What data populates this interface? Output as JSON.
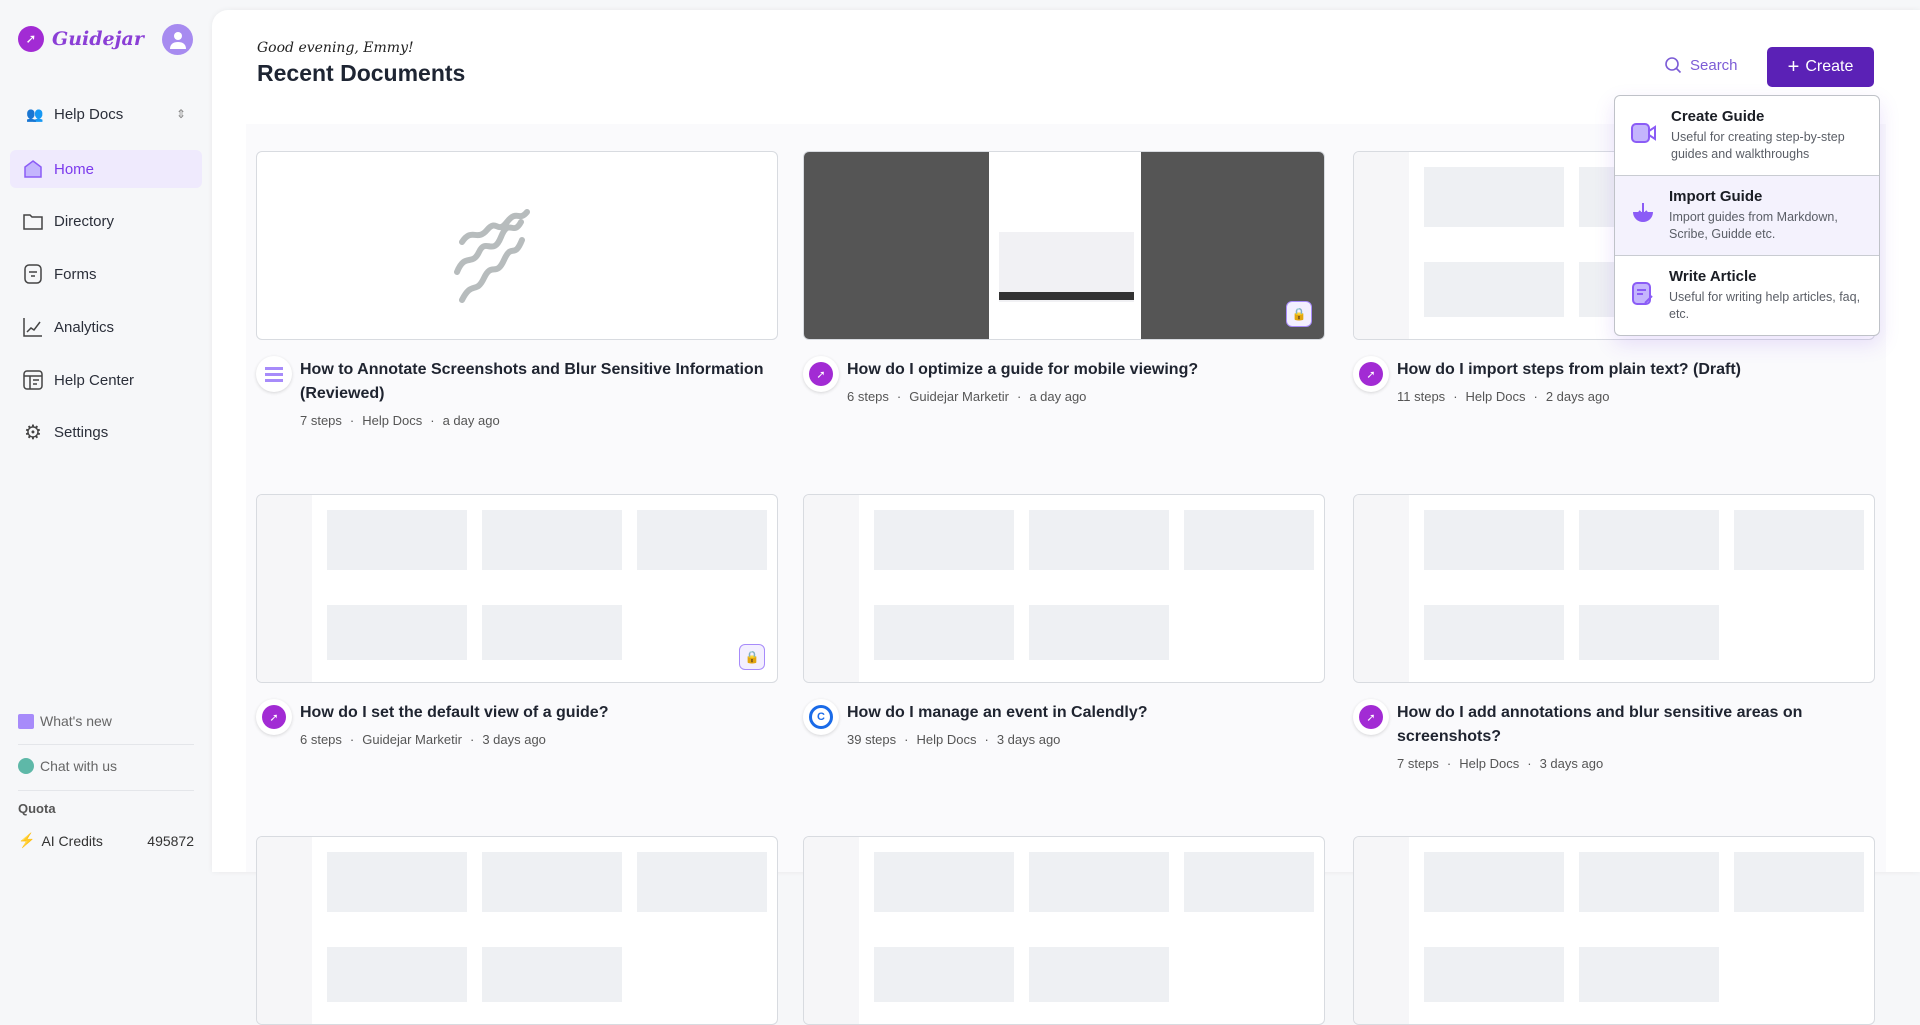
{
  "app": {
    "name": "Guidejar"
  },
  "sidebar": {
    "workspace": "Help Docs",
    "items": [
      {
        "label": "Home",
        "icon": "home-icon"
      },
      {
        "label": "Directory",
        "icon": "folder-icon"
      },
      {
        "label": "Forms",
        "icon": "form-icon"
      },
      {
        "label": "Analytics",
        "icon": "chart-icon"
      },
      {
        "label": "Help Center",
        "icon": "help-center-icon"
      },
      {
        "label": "Settings",
        "icon": "gear-icon"
      }
    ],
    "whats_new": "What's new",
    "chat": "Chat with us",
    "quota_label": "Quota",
    "credits_label": "AI Credits",
    "credits_value": "495872"
  },
  "header": {
    "greeting": "Good evening, Emmy!",
    "title": "Recent Documents",
    "search": "Search",
    "create": "Create"
  },
  "create_menu": [
    {
      "title": "Create Guide",
      "desc": "Useful for creating step-by-step guides and walkthroughs"
    },
    {
      "title": "Import Guide",
      "desc": "Import guides from Markdown, Scribe, Guidde etc."
    },
    {
      "title": "Write Article",
      "desc": "Useful for writing help articles, faq, etc."
    }
  ],
  "documents": [
    {
      "title": "How to Annotate Screenshots and Blur Sensitive Information (Reviewed)",
      "steps": "7 steps",
      "folder": "Help Docs",
      "time": "a day ago"
    },
    {
      "title": "How do I optimize a guide for mobile viewing?",
      "steps": "6 steps",
      "folder": "Guidejar Marketir",
      "time": "a day ago"
    },
    {
      "title": "How do I import steps from plain text? (Draft)",
      "steps": "11 steps",
      "folder": "Help Docs",
      "time": "2 days ago"
    },
    {
      "title": "How do I set the default view of a guide?",
      "steps": "6 steps",
      "folder": "Guidejar Marketir",
      "time": "3 days ago"
    },
    {
      "title": "How do I manage an event in Calendly?",
      "steps": "39 steps",
      "folder": "Help Docs",
      "time": "3 days ago"
    },
    {
      "title": "How do I add annotations and blur sensitive areas on screenshots?",
      "steps": "7 steps",
      "folder": "Help Docs",
      "time": "3 days ago"
    }
  ],
  "meta_separator": "·"
}
